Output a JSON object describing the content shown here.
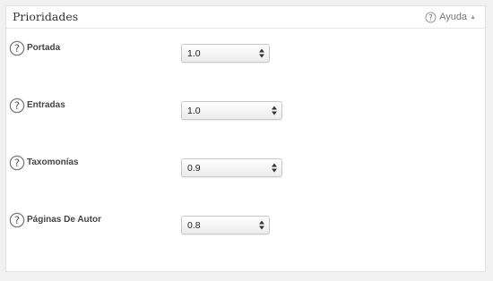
{
  "header": {
    "title": "Prioridades",
    "help_label": "Ayuda",
    "help_icon": "question-circle-icon",
    "caret_icon": "caret-up-icon"
  },
  "rows": [
    {
      "label": "Portada",
      "value": "1.0"
    },
    {
      "label": "Entradas",
      "value": "1.0"
    },
    {
      "label": "Taxomonías",
      "value": "0.9"
    },
    {
      "label": "Páginas De Autor",
      "value": "0.8"
    }
  ]
}
